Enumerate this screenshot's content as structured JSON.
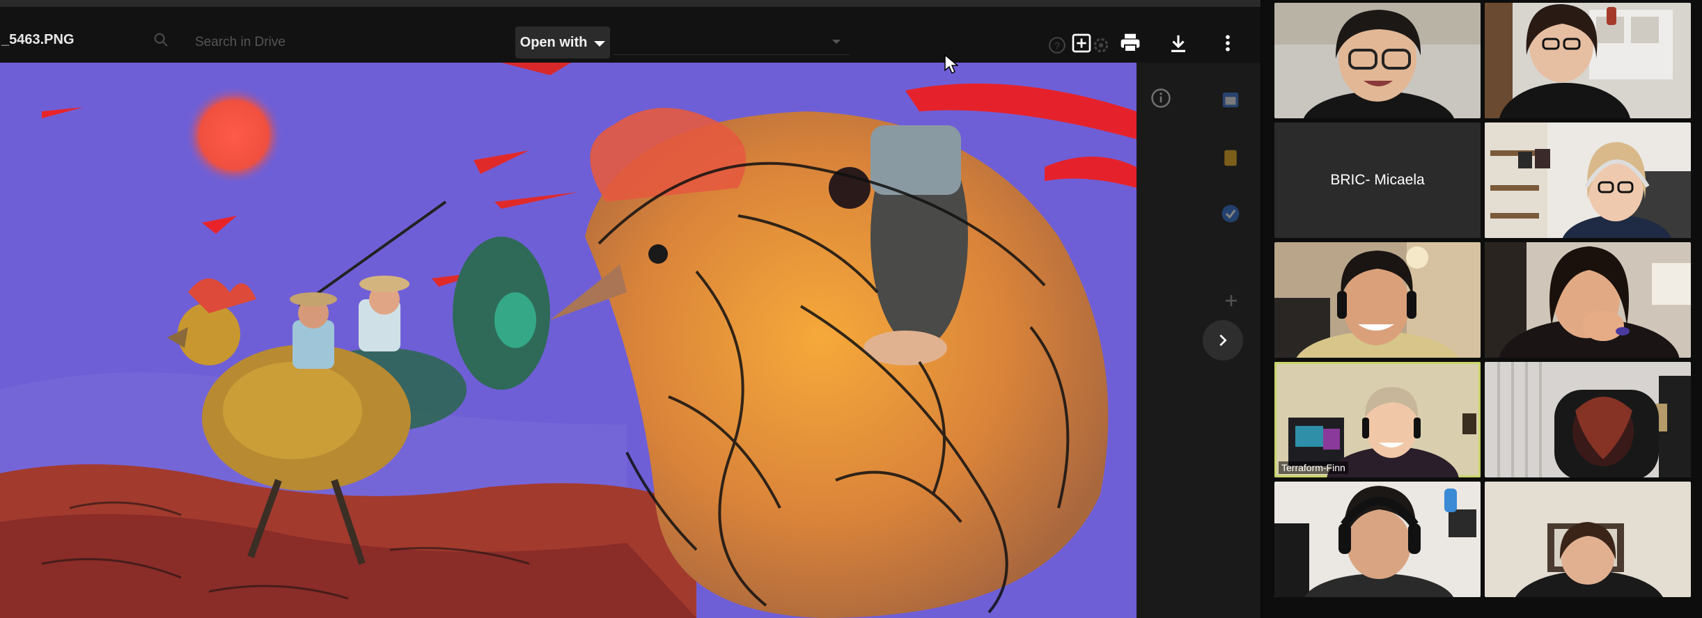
{
  "viewer": {
    "file_name": "_5463.PNG",
    "search_placeholder": "Search in Drive",
    "open_with_label": "Open with"
  },
  "toolbar_icons": [
    "add-to-drive-icon",
    "print-icon",
    "download-icon",
    "more-vert-icon"
  ],
  "side_icons": [
    "info-icon",
    "calendar-icon",
    "keep-icon",
    "tasks-icon",
    "add-icon"
  ],
  "participants": [
    {
      "name": "",
      "active": false
    },
    {
      "name": "",
      "active": false
    },
    {
      "name": "BRIC- Micaela",
      "active": false
    },
    {
      "name": "",
      "active": false
    },
    {
      "name": "",
      "active": false
    },
    {
      "name": "",
      "active": false
    },
    {
      "name": "Terraform-Finn",
      "active": true
    },
    {
      "name": "",
      "active": false
    },
    {
      "name": "",
      "active": false
    },
    {
      "name": "",
      "active": false
    }
  ]
}
